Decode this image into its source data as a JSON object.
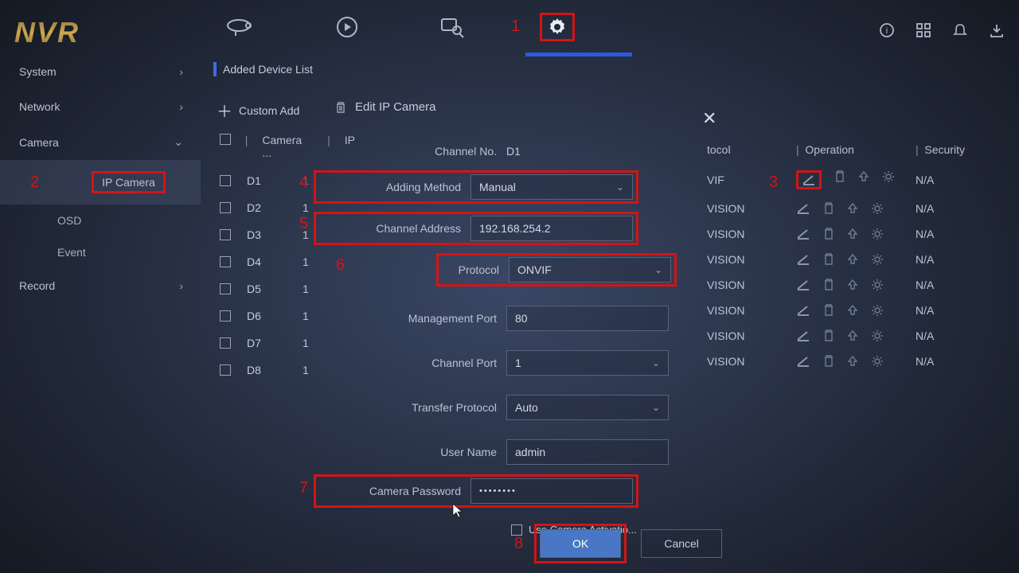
{
  "app": {
    "logo": "NVR"
  },
  "annotations": {
    "n1": "1",
    "n2": "2",
    "n3": "3",
    "n4": "4",
    "n5": "5",
    "n6": "6",
    "n7": "7",
    "n8": "8"
  },
  "sidebar": {
    "system": "System",
    "network": "Network",
    "camera": "Camera",
    "ip_camera": "IP Camera",
    "osd": "OSD",
    "event": "Event",
    "record": "Record"
  },
  "list": {
    "title": "Added Device List",
    "custom_add": "Custom Add",
    "edit_title": "Edit IP Camera",
    "hdr_camera": "Camera ...",
    "hdr_ip": "IP",
    "rows": [
      {
        "ch": "D1",
        "ip": "1"
      },
      {
        "ch": "D2",
        "ip": "1"
      },
      {
        "ch": "D3",
        "ip": "1"
      },
      {
        "ch": "D4",
        "ip": "1"
      },
      {
        "ch": "D5",
        "ip": "1"
      },
      {
        "ch": "D6",
        "ip": "1"
      },
      {
        "ch": "D7",
        "ip": "1"
      },
      {
        "ch": "D8",
        "ip": "1"
      }
    ]
  },
  "rtable": {
    "hdr_protocol": "tocol",
    "hdr_operation": "Operation",
    "hdr_security": "Security",
    "rows": [
      {
        "proto": "VIF",
        "sec": "N/A"
      },
      {
        "proto": "VISION",
        "sec": "N/A"
      },
      {
        "proto": "VISION",
        "sec": "N/A"
      },
      {
        "proto": "VISION",
        "sec": "N/A"
      },
      {
        "proto": "VISION",
        "sec": "N/A"
      },
      {
        "proto": "VISION",
        "sec": "N/A"
      },
      {
        "proto": "VISION",
        "sec": "N/A"
      },
      {
        "proto": "VISION",
        "sec": "N/A"
      }
    ]
  },
  "modal": {
    "channel_no_label": "Channel No.",
    "channel_no_value": "D1",
    "adding_method_label": "Adding Method",
    "adding_method_value": "Manual",
    "channel_address_label": "Channel Address",
    "channel_address_value": "192.168.254.2",
    "protocol_label": "Protocol",
    "protocol_value": "ONVIF",
    "mgmt_port_label": "Management Port",
    "mgmt_port_value": "80",
    "channel_port_label": "Channel Port",
    "channel_port_value": "1",
    "transfer_proto_label": "Transfer Protocol",
    "transfer_proto_value": "Auto",
    "username_label": "User Name",
    "username_value": "admin",
    "password_label": "Camera Password",
    "password_value": "••••••••",
    "use_activation": "Use Camera Activatio...",
    "ok": "OK",
    "cancel": "Cancel"
  }
}
